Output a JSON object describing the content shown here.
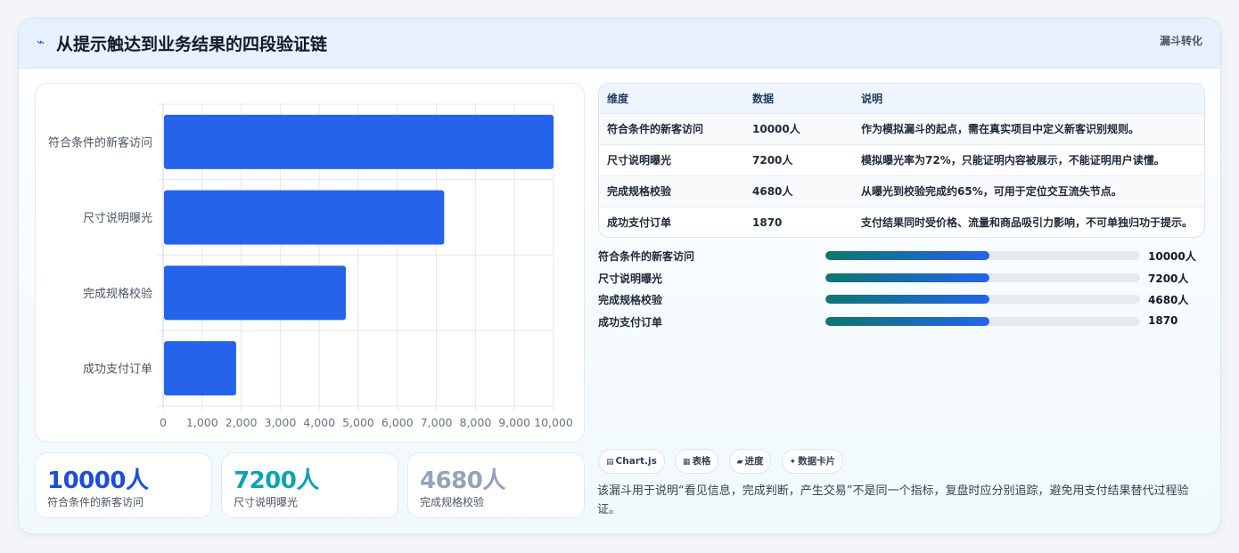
{
  "header": {
    "icon": "chart-line-icon",
    "title": "从提示触达到业务结果的四段验证链",
    "badge": "漏斗转化"
  },
  "colors": {
    "bar": "#2563eb",
    "stat_blue": "#1d4ed8",
    "stat_teal": "#0fa3b1",
    "stat_gray": "#94a3b8",
    "progress_start": "#0f766e",
    "progress_end": "#2563eb"
  },
  "chart_data": {
    "type": "bar",
    "orientation": "horizontal",
    "categories": [
      "符合条件的新客访问",
      "尺寸说明曝光",
      "完成规格校验",
      "成功支付订单"
    ],
    "values": [
      10000,
      7200,
      4680,
      1870
    ],
    "xlim": [
      0,
      10000
    ],
    "xticks": [
      "0",
      "1,000",
      "2,000",
      "3,000",
      "4,000",
      "5,000",
      "6,000",
      "7,000",
      "8,000",
      "9,000",
      "10,000"
    ],
    "grid": true,
    "legend": "none"
  },
  "stats": [
    {
      "value": "10000人",
      "label": "符合条件的新客访问"
    },
    {
      "value": "7200人",
      "label": "尺寸说明曝光"
    },
    {
      "value": "4680人",
      "label": "完成规格校验"
    }
  ],
  "table": {
    "headers": [
      "维度",
      "数据",
      "说明"
    ],
    "rows": [
      [
        "符合条件的新客访问",
        "10000人",
        "作为模拟漏斗的起点，需在真实项目中定义新客识别规则。"
      ],
      [
        "尺寸说明曝光",
        "7200人",
        "模拟曝光率为72%，只能证明内容被展示，不能证明用户读懂。"
      ],
      [
        "完成规格校验",
        "4680人",
        "从曝光到校验完成约65%，可用于定位交互流失节点。"
      ],
      [
        "成功支付订单",
        "1870",
        "支付结果同时受价格、流量和商品吸引力影响，不可单独归功于提示。"
      ]
    ]
  },
  "progress": [
    {
      "label": "符合条件的新客访问",
      "value": "10000人",
      "fill": 0.52
    },
    {
      "label": "尺寸说明曝光",
      "value": "7200人",
      "fill": 0.52
    },
    {
      "label": "完成规格校验",
      "value": "4680人",
      "fill": 0.52
    },
    {
      "label": "成功支付订单",
      "value": "1870",
      "fill": 0.52
    }
  ],
  "chips": [
    {
      "icon": "chart-icon",
      "glyph": "▤",
      "label": "Chart.js"
    },
    {
      "icon": "table-icon",
      "glyph": "▦",
      "label": "表格"
    },
    {
      "icon": "progress-icon",
      "glyph": "▰",
      "label": "进度"
    },
    {
      "icon": "sparkle-icon",
      "glyph": "✦",
      "label": "数据卡片"
    }
  ],
  "note": "该漏斗用于说明“看见信息，完成判断，产生交易”不是同一个指标，复盘时应分别追踪，避免用支付结果替代过程验证。"
}
